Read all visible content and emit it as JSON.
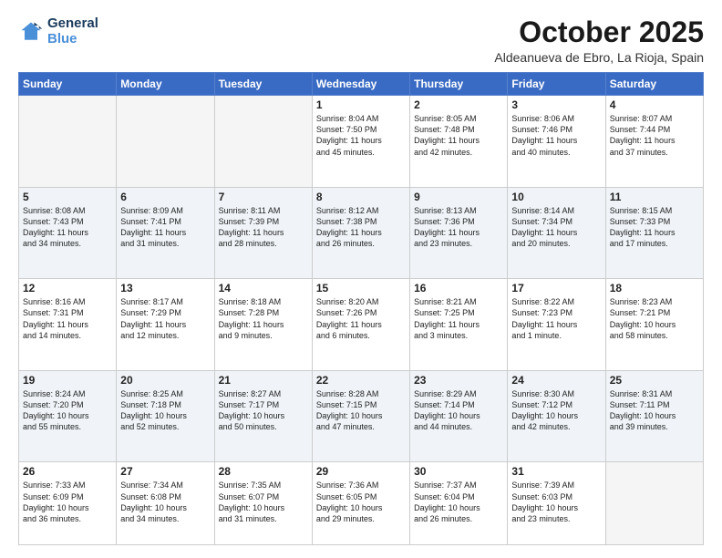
{
  "header": {
    "logo_line1": "General",
    "logo_line2": "Blue",
    "month": "October 2025",
    "location": "Aldeanueva de Ebro, La Rioja, Spain"
  },
  "weekdays": [
    "Sunday",
    "Monday",
    "Tuesday",
    "Wednesday",
    "Thursday",
    "Friday",
    "Saturday"
  ],
  "weeks": [
    [
      {
        "day": "",
        "info": ""
      },
      {
        "day": "",
        "info": ""
      },
      {
        "day": "",
        "info": ""
      },
      {
        "day": "1",
        "info": "Sunrise: 8:04 AM\nSunset: 7:50 PM\nDaylight: 11 hours\nand 45 minutes."
      },
      {
        "day": "2",
        "info": "Sunrise: 8:05 AM\nSunset: 7:48 PM\nDaylight: 11 hours\nand 42 minutes."
      },
      {
        "day": "3",
        "info": "Sunrise: 8:06 AM\nSunset: 7:46 PM\nDaylight: 11 hours\nand 40 minutes."
      },
      {
        "day": "4",
        "info": "Sunrise: 8:07 AM\nSunset: 7:44 PM\nDaylight: 11 hours\nand 37 minutes."
      }
    ],
    [
      {
        "day": "5",
        "info": "Sunrise: 8:08 AM\nSunset: 7:43 PM\nDaylight: 11 hours\nand 34 minutes."
      },
      {
        "day": "6",
        "info": "Sunrise: 8:09 AM\nSunset: 7:41 PM\nDaylight: 11 hours\nand 31 minutes."
      },
      {
        "day": "7",
        "info": "Sunrise: 8:11 AM\nSunset: 7:39 PM\nDaylight: 11 hours\nand 28 minutes."
      },
      {
        "day": "8",
        "info": "Sunrise: 8:12 AM\nSunset: 7:38 PM\nDaylight: 11 hours\nand 26 minutes."
      },
      {
        "day": "9",
        "info": "Sunrise: 8:13 AM\nSunset: 7:36 PM\nDaylight: 11 hours\nand 23 minutes."
      },
      {
        "day": "10",
        "info": "Sunrise: 8:14 AM\nSunset: 7:34 PM\nDaylight: 11 hours\nand 20 minutes."
      },
      {
        "day": "11",
        "info": "Sunrise: 8:15 AM\nSunset: 7:33 PM\nDaylight: 11 hours\nand 17 minutes."
      }
    ],
    [
      {
        "day": "12",
        "info": "Sunrise: 8:16 AM\nSunset: 7:31 PM\nDaylight: 11 hours\nand 14 minutes."
      },
      {
        "day": "13",
        "info": "Sunrise: 8:17 AM\nSunset: 7:29 PM\nDaylight: 11 hours\nand 12 minutes."
      },
      {
        "day": "14",
        "info": "Sunrise: 8:18 AM\nSunset: 7:28 PM\nDaylight: 11 hours\nand 9 minutes."
      },
      {
        "day": "15",
        "info": "Sunrise: 8:20 AM\nSunset: 7:26 PM\nDaylight: 11 hours\nand 6 minutes."
      },
      {
        "day": "16",
        "info": "Sunrise: 8:21 AM\nSunset: 7:25 PM\nDaylight: 11 hours\nand 3 minutes."
      },
      {
        "day": "17",
        "info": "Sunrise: 8:22 AM\nSunset: 7:23 PM\nDaylight: 11 hours\nand 1 minute."
      },
      {
        "day": "18",
        "info": "Sunrise: 8:23 AM\nSunset: 7:21 PM\nDaylight: 10 hours\nand 58 minutes."
      }
    ],
    [
      {
        "day": "19",
        "info": "Sunrise: 8:24 AM\nSunset: 7:20 PM\nDaylight: 10 hours\nand 55 minutes."
      },
      {
        "day": "20",
        "info": "Sunrise: 8:25 AM\nSunset: 7:18 PM\nDaylight: 10 hours\nand 52 minutes."
      },
      {
        "day": "21",
        "info": "Sunrise: 8:27 AM\nSunset: 7:17 PM\nDaylight: 10 hours\nand 50 minutes."
      },
      {
        "day": "22",
        "info": "Sunrise: 8:28 AM\nSunset: 7:15 PM\nDaylight: 10 hours\nand 47 minutes."
      },
      {
        "day": "23",
        "info": "Sunrise: 8:29 AM\nSunset: 7:14 PM\nDaylight: 10 hours\nand 44 minutes."
      },
      {
        "day": "24",
        "info": "Sunrise: 8:30 AM\nSunset: 7:12 PM\nDaylight: 10 hours\nand 42 minutes."
      },
      {
        "day": "25",
        "info": "Sunrise: 8:31 AM\nSunset: 7:11 PM\nDaylight: 10 hours\nand 39 minutes."
      }
    ],
    [
      {
        "day": "26",
        "info": "Sunrise: 7:33 AM\nSunset: 6:09 PM\nDaylight: 10 hours\nand 36 minutes."
      },
      {
        "day": "27",
        "info": "Sunrise: 7:34 AM\nSunset: 6:08 PM\nDaylight: 10 hours\nand 34 minutes."
      },
      {
        "day": "28",
        "info": "Sunrise: 7:35 AM\nSunset: 6:07 PM\nDaylight: 10 hours\nand 31 minutes."
      },
      {
        "day": "29",
        "info": "Sunrise: 7:36 AM\nSunset: 6:05 PM\nDaylight: 10 hours\nand 29 minutes."
      },
      {
        "day": "30",
        "info": "Sunrise: 7:37 AM\nSunset: 6:04 PM\nDaylight: 10 hours\nand 26 minutes."
      },
      {
        "day": "31",
        "info": "Sunrise: 7:39 AM\nSunset: 6:03 PM\nDaylight: 10 hours\nand 23 minutes."
      },
      {
        "day": "",
        "info": ""
      }
    ]
  ]
}
